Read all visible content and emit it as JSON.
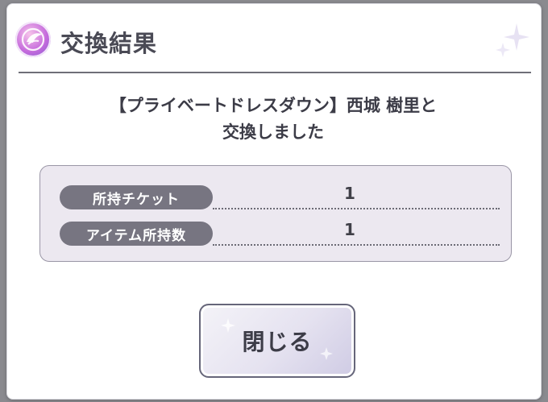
{
  "dialog": {
    "title": "交換結果",
    "header_icon": "winged-emblem-icon",
    "decoration_icon": "sparkle-icon",
    "message_line1": "【プライベートドレスダウン】西城 樹里と",
    "message_line2": "交換しました",
    "rows": [
      {
        "label": "所持チケット",
        "value": "1"
      },
      {
        "label": "アイテム所持数",
        "value": "1"
      }
    ],
    "close_label": "閉じる"
  }
}
